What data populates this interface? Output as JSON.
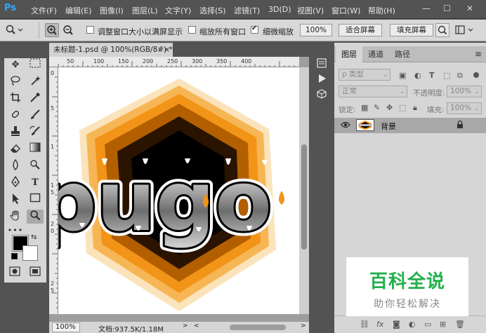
{
  "app": {
    "logo": "Ps"
  },
  "menu": {
    "items": [
      "文件(F)",
      "编辑(E)",
      "图像(I)",
      "图层(L)",
      "文字(Y)",
      "选择(S)",
      "滤镜(T)",
      "3D(D)",
      "视图(V)",
      "窗口(W)",
      "帮助(H)"
    ]
  },
  "window_controls": {
    "minimize": "—",
    "maximize": "☐",
    "close": "✕"
  },
  "options": {
    "resize_windows_label": "调整窗口大小以满屏显示",
    "zoom_all_label": "缩放所有窗口",
    "scrubby_zoom_label": "细微缩放",
    "zoom_100_label": "100%",
    "fit_screen_label": "适合屏幕",
    "fill_screen_label": "填充屏幕"
  },
  "document": {
    "tab_title": "未标题-1.psd @ 100%(RGB/8#) *",
    "close_glyph": "×",
    "ruler_h_labels": [
      "50",
      "100",
      "150",
      "200",
      "250",
      "300",
      "350",
      "400"
    ],
    "ruler_v_labels": [
      "0",
      "5",
      "1",
      "1",
      "5",
      "2",
      "0",
      "2",
      "5"
    ],
    "status_zoom": "100%",
    "status_doc": "文档:937.5K/1.18M"
  },
  "layers_panel": {
    "tabs": [
      "图层",
      "通道",
      "路径"
    ],
    "filter_label": "类型",
    "blend_mode": "正常",
    "opacity_label": "不透明度:",
    "opacity_value": "100%",
    "lock_label": "锁定:",
    "fill_label": "填充:",
    "fill_value": "100%",
    "layer_name": "背景"
  },
  "watermark": {
    "title": "百科全说",
    "subtitle": "助你轻松解决"
  },
  "colors": {
    "accent": "#31a8ff",
    "artwork_orange": "#f5a623",
    "watermark_green": "#22b04b"
  }
}
